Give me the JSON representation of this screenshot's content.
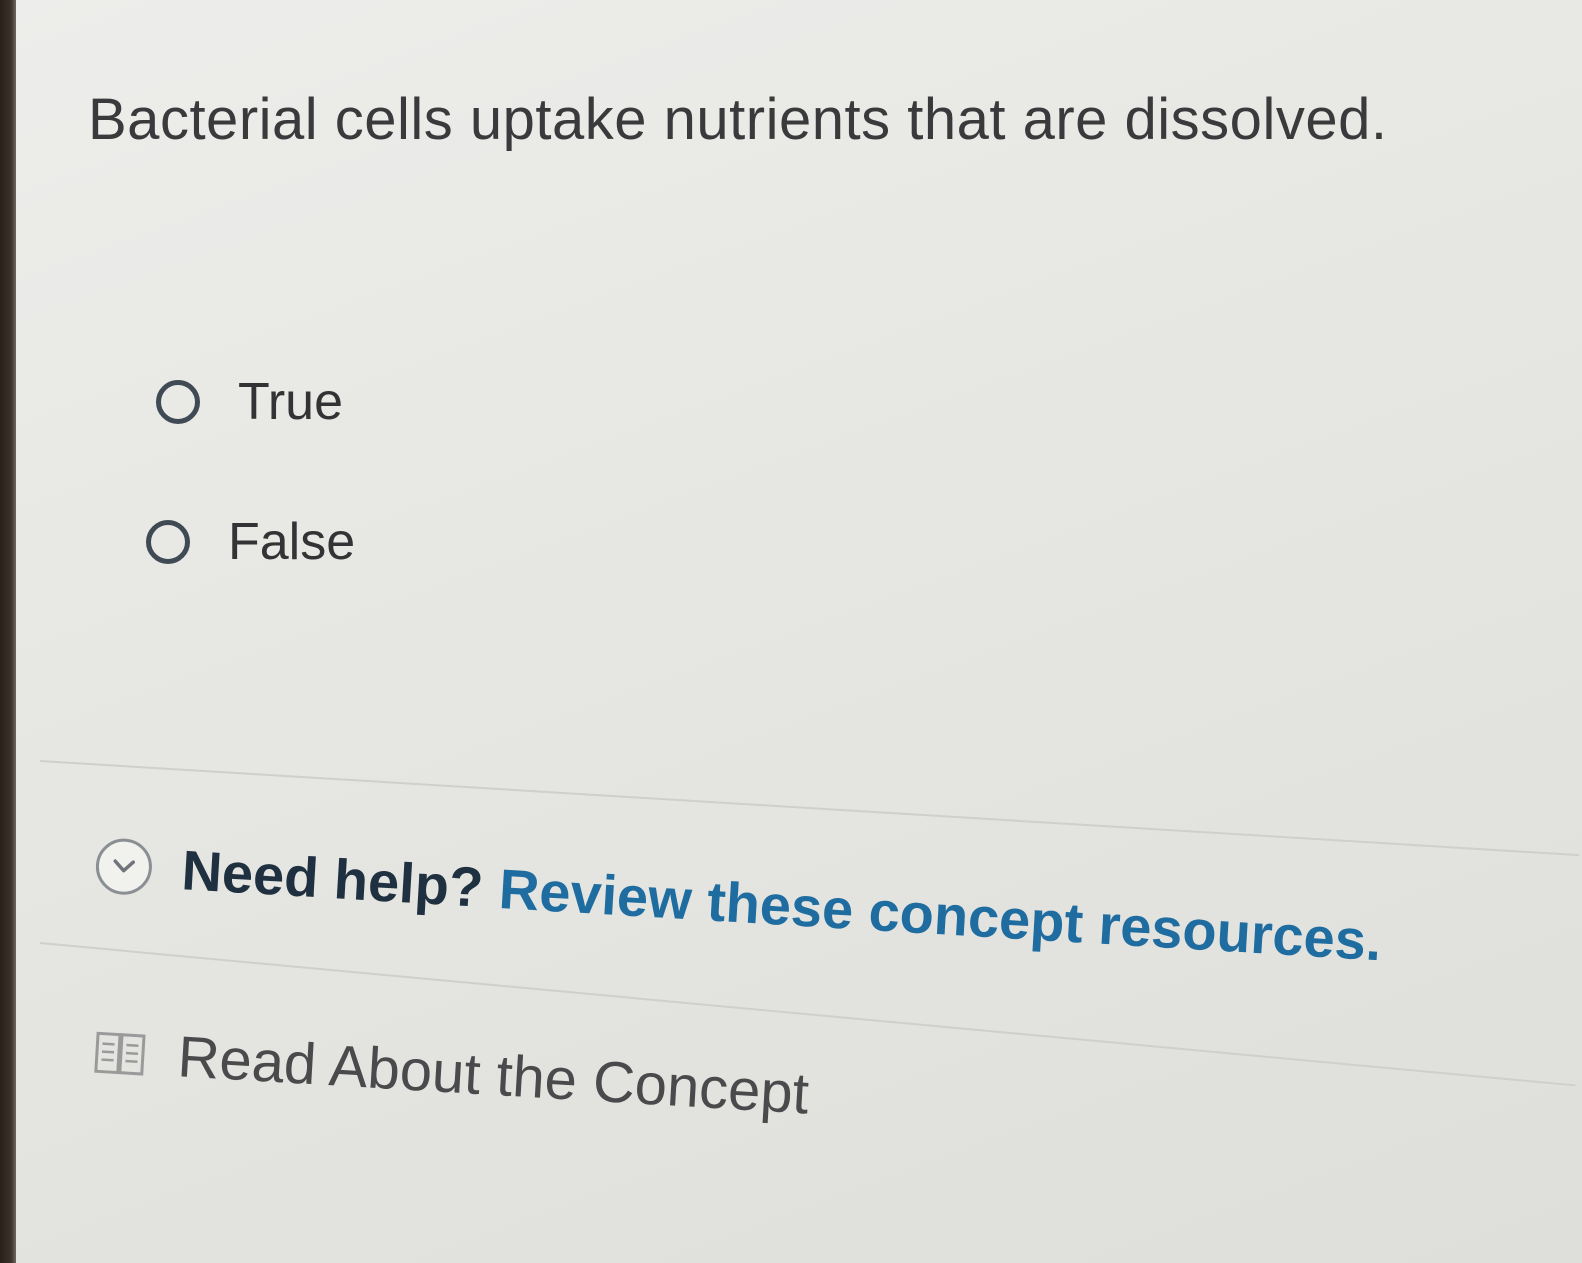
{
  "question": {
    "text": "Bacterial cells uptake nutrients that are dissolved."
  },
  "options": [
    {
      "label": "True",
      "selected": false
    },
    {
      "label": "False",
      "selected": false
    }
  ],
  "help": {
    "prefix": "Need help?",
    "link_text": "Review these concept resources.",
    "icon": "chevron-down-icon"
  },
  "resources": [
    {
      "label": "Read About the Concept",
      "icon": "book-icon"
    }
  ],
  "colors": {
    "link": "#1f6da0",
    "text": "#3a3a3c",
    "radio_border": "#3f4a54"
  }
}
